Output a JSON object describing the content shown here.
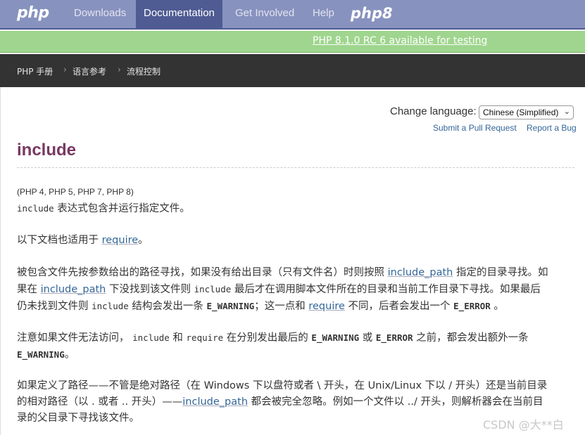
{
  "nav": {
    "logo": "php",
    "items": [
      "Downloads",
      "Documentation",
      "Get Involved",
      "Help"
    ],
    "active_index": 1,
    "logo8": "php8"
  },
  "banner": {
    "text": "PHP 8.1.0 RC 6 available for testing"
  },
  "breadcrumb": [
    "PHP 手册",
    "语言参考",
    "流程控制"
  ],
  "language": {
    "label": "Change language:",
    "selected": "Chinese (Simplified)",
    "links": [
      "Submit a Pull Request",
      "Report a Bug"
    ]
  },
  "page": {
    "title": "include",
    "versions": "(PHP 4, PHP 5, PHP 7, PHP 8)",
    "p1": {
      "code": "include",
      "text": " 表达式包含并运行指定文件。"
    },
    "p2": {
      "a": "以下文档也适用于 ",
      "link": "require",
      "b": "。"
    },
    "p3": {
      "l1a": "被包含文件先按参数给出的路径寻找，如果没有给出目录（只有文件名）时则按照 ",
      "l1link": "include_path",
      "l1b": " 指定的目录寻找。如",
      "l2a": "果在 ",
      "l2link": "include_path",
      "l2b": " 下没找到该文件则 ",
      "l2code": "include",
      "l2c": " 最后才在调用脚本文件所在的目录和当前工作目录下寻找。如果最后",
      "l3a": "仍未找到文件则 ",
      "l3code": "include",
      "l3b": " 结构会发出一条 ",
      "l3warn": "E_WARNING",
      "l3c": "；这一点和 ",
      "l3link": "require",
      "l3d": " 不同，后者会发出一个 ",
      "l3err": "E_ERROR",
      "l3e": " 。"
    },
    "p4": {
      "l1a": "注意如果文件无法访问， ",
      "code1": "include",
      "l1b": " 和 ",
      "code2": "require",
      "l1c": " 在分别发出最后的 ",
      "warn": "E_WARNING",
      "l1d": " 或 ",
      "err": "E_ERROR",
      "l1e": " 之前，都会发出额外一条",
      "l2warn": "E_WARNING",
      "l2b": "。"
    },
    "p5": {
      "l1": "如果定义了路径——不管是绝对路径（在 Windows 下以盘符或者 \\ 开头，在 Unix/Linux 下以 / 开头）还是当前目录",
      "l2a": "的相对路径（以 . 或者 .. 开头）——",
      "l2link": "include_path",
      "l2b": " 都会被完全忽略。例如一个文件以 ../ 开头，则解析器会在当前目",
      "l3": "录的父目录下寻找该文件。"
    }
  },
  "watermark": "CSDN @大**白"
}
